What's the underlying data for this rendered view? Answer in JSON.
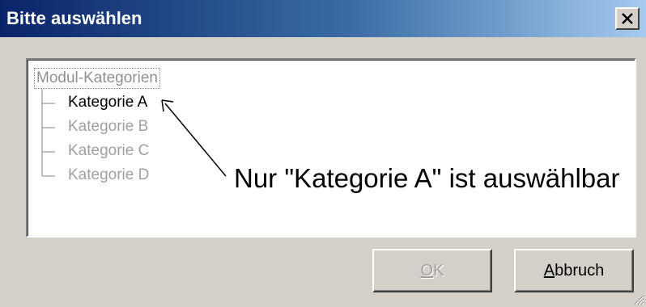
{
  "window": {
    "title": "Bitte auswählen",
    "close_icon": "close-icon"
  },
  "tree": {
    "root_label": "Modul-Kategorien",
    "items": [
      {
        "label": "Kategorie A",
        "enabled": true
      },
      {
        "label": "Kategorie B",
        "enabled": false
      },
      {
        "label": "Kategorie C",
        "enabled": false
      },
      {
        "label": "Kategorie D",
        "enabled": false
      }
    ]
  },
  "annotation": {
    "text": "Nur \"Kategorie A\" ist auswählbar"
  },
  "buttons": {
    "ok": {
      "mnemonic": "O",
      "rest": "K",
      "enabled": false
    },
    "cancel": {
      "mnemonic": "A",
      "rest": "bbruch",
      "enabled": true
    }
  },
  "colors": {
    "title_gradient_start": "#0a246a",
    "title_gradient_end": "#a6caf0",
    "dialog_bg": "#d4d0c8",
    "disabled_text": "#a0a0a0"
  }
}
